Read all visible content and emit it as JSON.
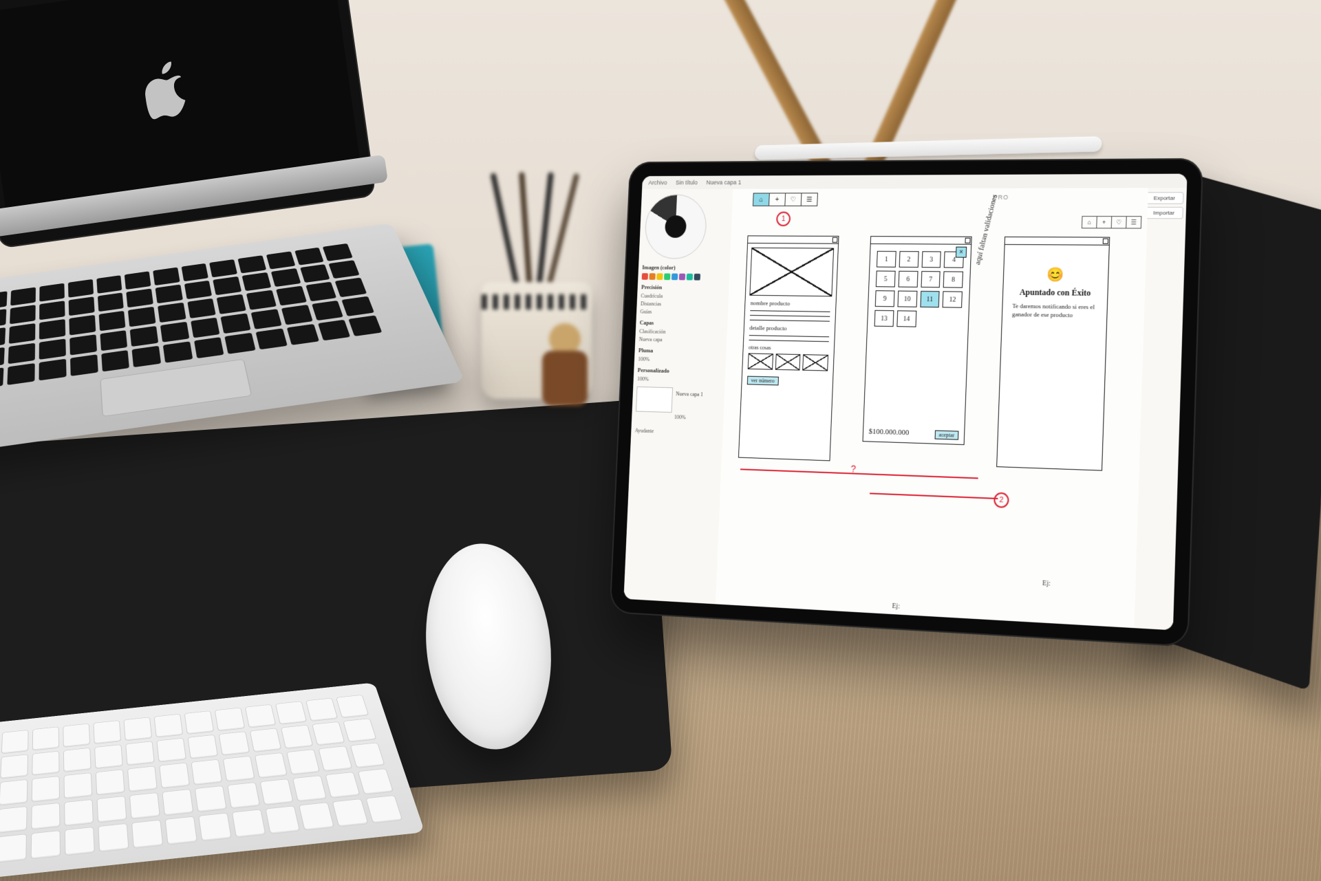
{
  "app": {
    "topbar": {
      "item1": "Archivo",
      "item2": "Sin título",
      "item3": "Nueva capa 1"
    },
    "pro_badge": "PRO",
    "right": {
      "export": "Exportar",
      "import": "Importar"
    }
  },
  "side": {
    "heading_image": "Imagen (color)",
    "heading_precision": "Precisión",
    "rows_precision": [
      "Cuadrícula",
      "Distancias",
      "Guías"
    ],
    "heading_layers": "Capas",
    "rows_layers": [
      "Clasificación",
      "Nueva capa"
    ],
    "heading_brush": "Pluma",
    "row_brush": "100%",
    "heading_custom": "Personalizado",
    "row_custom": "100%",
    "thumb_label": "Nueva capa 1",
    "thumb_sub": "100%",
    "footer": "Ayudante"
  },
  "toolbar_icons": [
    "⌂",
    "+",
    "♡",
    "☰"
  ],
  "wf1": {
    "title": "nombre producto",
    "subtitle": "detalle producto",
    "section": "otras cosas",
    "cta": "ver número"
  },
  "wf2": {
    "keys": [
      "1",
      "2",
      "3",
      "4",
      "5",
      "6",
      "7",
      "8",
      "9",
      "10",
      "11",
      "12",
      "13",
      "14"
    ],
    "highlight_index": 10,
    "price": "$100.000.000",
    "cta": "aceptar"
  },
  "wf3": {
    "emoji": "😊",
    "title": "Apuntado con Éxito",
    "body": "Te daremos notificando si eres el ganador de ese producto"
  },
  "sidenote": "aquí faltan validaciones",
  "flow": {
    "step1": "1",
    "step2": "2",
    "q": "?"
  },
  "ej": "Ej:"
}
